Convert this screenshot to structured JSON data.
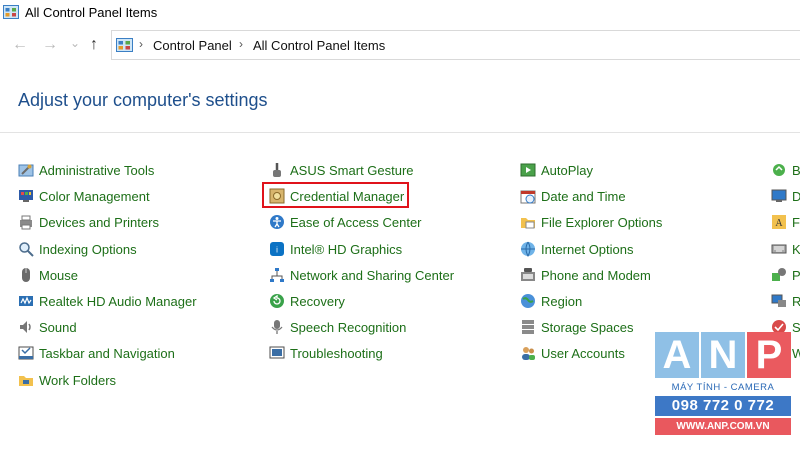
{
  "window": {
    "title": "All Control Panel Items"
  },
  "nav": {
    "back_icon": "←",
    "forward_icon": "→",
    "down_icon": "⌄",
    "up_icon": "↑"
  },
  "breadcrumb": {
    "sep": "›",
    "items": [
      "Control Panel",
      "All Control Panel Items"
    ]
  },
  "main": {
    "heading": "Adjust your computer's settings"
  },
  "columns": [
    {
      "items": [
        {
          "label": "Administrative Tools",
          "icon": "admin-tools-icon"
        },
        {
          "label": "Color Management",
          "icon": "color-management-icon"
        },
        {
          "label": "Devices and Printers",
          "icon": "devices-printers-icon"
        },
        {
          "label": "Indexing Options",
          "icon": "indexing-options-icon"
        },
        {
          "label": "Mouse",
          "icon": "mouse-icon"
        },
        {
          "label": "Realtek HD Audio Manager",
          "icon": "realtek-audio-icon"
        },
        {
          "label": "Sound",
          "icon": "sound-icon"
        },
        {
          "label": "Taskbar and Navigation",
          "icon": "taskbar-icon"
        },
        {
          "label": "Work Folders",
          "icon": "work-folders-icon"
        }
      ]
    },
    {
      "items": [
        {
          "label": "ASUS Smart Gesture",
          "icon": "asus-gesture-icon"
        },
        {
          "label": "Credential Manager",
          "icon": "credential-manager-icon",
          "highlighted": true
        },
        {
          "label": "Ease of Access Center",
          "icon": "ease-of-access-icon"
        },
        {
          "label": "Intel® HD Graphics",
          "icon": "intel-graphics-icon"
        },
        {
          "label": "Network and Sharing Center",
          "icon": "network-sharing-icon"
        },
        {
          "label": "Recovery",
          "icon": "recovery-icon"
        },
        {
          "label": "Speech Recognition",
          "icon": "speech-recognition-icon"
        },
        {
          "label": "Troubleshooting",
          "icon": "troubleshooting-icon"
        }
      ]
    },
    {
      "items": [
        {
          "label": "AutoPlay",
          "icon": "autoplay-icon"
        },
        {
          "label": "Date and Time",
          "icon": "date-time-icon"
        },
        {
          "label": "File Explorer Options",
          "icon": "file-explorer-options-icon"
        },
        {
          "label": "Internet Options",
          "icon": "internet-options-icon"
        },
        {
          "label": "Phone and Modem",
          "icon": "phone-modem-icon"
        },
        {
          "label": "Region",
          "icon": "region-icon"
        },
        {
          "label": "Storage Spaces",
          "icon": "storage-spaces-icon"
        },
        {
          "label": "User Accounts",
          "icon": "user-accounts-icon"
        }
      ]
    },
    {
      "items": [
        {
          "label": "B",
          "icon": "backup-icon"
        },
        {
          "label": "D",
          "icon": "display-icon"
        },
        {
          "label": "F",
          "icon": "fonts-icon"
        },
        {
          "label": "K",
          "icon": "keyboard-icon"
        },
        {
          "label": "P",
          "icon": "programs-icon"
        },
        {
          "label": "R",
          "icon": "remote-icon"
        },
        {
          "label": "S",
          "icon": "security-icon"
        },
        {
          "label": "W",
          "icon": "windows-icon"
        }
      ]
    }
  ],
  "watermark": {
    "letters": [
      "A",
      "N",
      "P"
    ],
    "subtitle": "MÁY TÍNH - CAMERA",
    "phone": "098 772 0 772",
    "url": "WWW.ANP.COM.VN"
  },
  "colors": {
    "link": "#1d6f18",
    "heading": "#1e4f8c",
    "highlight": "#e0131b"
  }
}
